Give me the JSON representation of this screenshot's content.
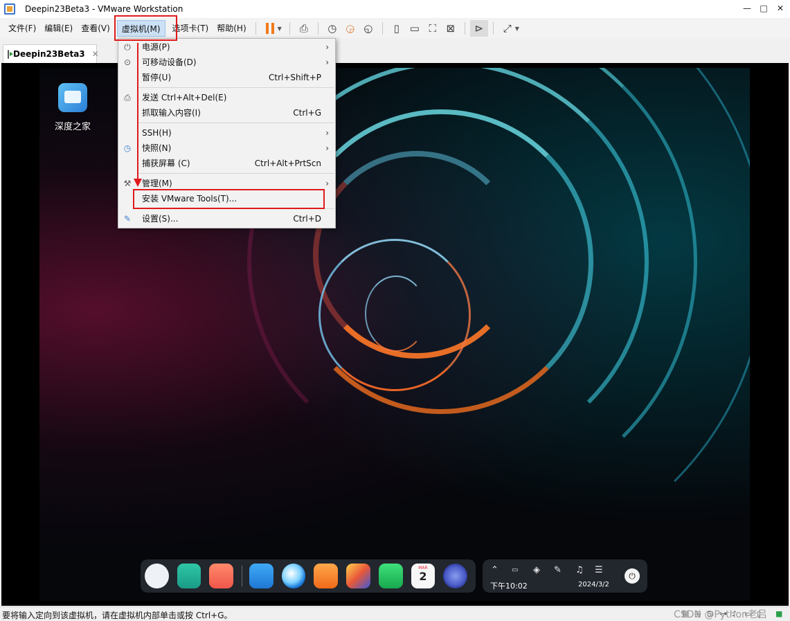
{
  "window": {
    "title": "Deepin23Beta3 - VMware Workstation",
    "minimize": "—",
    "maximize": "□",
    "close": "✕"
  },
  "menubar": {
    "items": [
      "文件(F)",
      "编辑(E)",
      "查看(V)",
      "虚拟机(M)",
      "选项卡(T)",
      "帮助(H)"
    ],
    "active_item": "虚拟机(M)"
  },
  "tab": {
    "label": "Deepin23Beta3",
    "close": "✕"
  },
  "vm_menu": {
    "items": [
      {
        "label": "电源(P)",
        "shortcut": "",
        "submenu": "›",
        "icon": "power-icon"
      },
      {
        "label": "可移动设备(D)",
        "shortcut": "",
        "submenu": "›",
        "icon": "removable-device-icon"
      },
      {
        "label": "暂停(U)",
        "shortcut": "Ctrl+Shift+P",
        "submenu": "",
        "icon": ""
      },
      {
        "label": "发送 Ctrl+Alt+Del(E)",
        "shortcut": "",
        "submenu": "",
        "icon": "send-keys-icon"
      },
      {
        "label": "抓取输入内容(I)",
        "shortcut": "Ctrl+G",
        "submenu": "",
        "icon": ""
      },
      {
        "label": "SSH(H)",
        "shortcut": "",
        "submenu": "›",
        "icon": ""
      },
      {
        "label": "快照(N)",
        "shortcut": "",
        "submenu": "›",
        "icon": "snapshot-icon"
      },
      {
        "label": "捕获屏幕 (C)",
        "shortcut": "Ctrl+Alt+PrtScn",
        "submenu": "",
        "icon": ""
      },
      {
        "label": "管理(M)",
        "shortcut": "",
        "submenu": "›",
        "icon": "wrench-icon"
      },
      {
        "label": "安装 VMware Tools(T)...",
        "shortcut": "",
        "submenu": "",
        "icon": ""
      },
      {
        "label": "设置(S)...",
        "shortcut": "Ctrl+D",
        "submenu": "",
        "icon": "settings-icon"
      }
    ]
  },
  "desktop": {
    "icon_label": "深度之家"
  },
  "tray": {
    "time": "下午10:02",
    "date": "2024/3/2",
    "calendar_day": "2",
    "calendar_month": "MAR"
  },
  "statusbar": {
    "text": "要将输入定向到该虚拟机，请在虚拟机内部单击或按 Ctrl+G。",
    "watermark": "CSDN @Python老吕"
  },
  "colors": {
    "annotation": "#e0191b",
    "pause_accent": "#f07a1a",
    "menu_highlight": "#cce1f5"
  }
}
